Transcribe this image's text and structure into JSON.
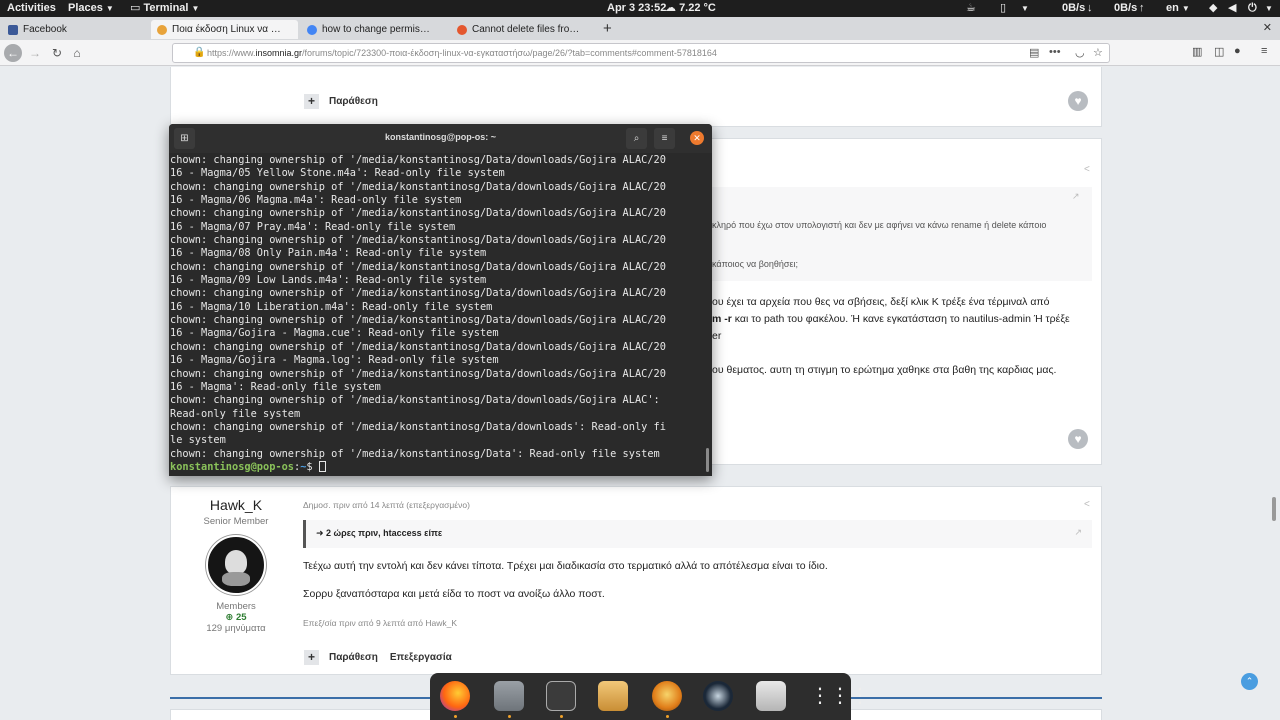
{
  "topbar": {
    "activities": "Activities",
    "places": "Places",
    "app_menu": "Terminal",
    "clock": "Apr 3  23:52",
    "weather": "7.22 °C",
    "net_down": "0B/s",
    "net_up": "0B/s",
    "keyboard": "en"
  },
  "browser": {
    "tabs": [
      {
        "label": "Facebook",
        "favicon_color": "#3b5998"
      },
      {
        "label": "Ποια έκδοση Linux να εγκαταστήσω",
        "favicon_color": "#e8a33a"
      },
      {
        "label": "how to change permissions",
        "favicon_color": "#4285f4"
      },
      {
        "label": "Cannot delete files from my",
        "favicon_color": "#e4572e"
      }
    ],
    "url_prefix": "https://www.",
    "url_host": "insomnia.gr",
    "url_path": "/forums/topic/723300-ποια-έκδοση-linux-να-εγκαταστήσω/page/26/?tab=comments#comment-57818164"
  },
  "page": {
    "post1_actions": {
      "quote_label": "Παράθεση"
    },
    "post2": {
      "quote_line1": "κληρό που έχω στον υπολογιστή και δεν με αφήνει να κάνω rename ή delete κάποιο",
      "quote_line2": "κάποιος να βοηθήσει;",
      "body_line1": "ου έχει τα αρχεία που θες να σβήσεις, δεξί κλικ Κ τρέξε ένα τέρμιναλ από",
      "body_line2_bold": "m -r",
      "body_line2_rest": " και το path του φακέλου. Ή κανε εγκατάσταση το nautilus-admin Ή τρέξε",
      "body_line3": "er",
      "body_line4": "ου θεματος. αυτη τη στιγμη το ερώτημα χαθηκε στα βαθη της καρδιας μας."
    },
    "post3": {
      "author": "Hawk_K",
      "rank": "Senior Member",
      "group": "Members",
      "reputation": "25",
      "post_count": "129 μηνύματα",
      "meta": "Δημοσ. πριν από 14 λεπτά (επεξεργασμένο)",
      "quote_header": "2 ώρες πριν, htaccess είπε",
      "body1": "Τεέχω αυτή την εντολή και δεν κάνει τίποτα. Τρέχει μαι διαδικασία στο τερματικό αλλά το απότέλεσμα είναι το ίδιο.",
      "body2": "Σορρυ ξαναπόσταρα και μετά είδα το ποστ να ανοίξω άλλο ποστ.",
      "edited": "Επεξ/σία πριν από 9 λεπτά από Hawk_K",
      "quote_label": "Παράθεση",
      "edit_label": "Επεξεργασία"
    }
  },
  "terminal": {
    "title": "konstantinosg@pop-os: ~",
    "lines": [
      "chown: changing ownership of '/media/konstantinosg/Data/downloads/Gojira ALAC/20",
      "16 - Magma/05 Yellow Stone.m4a': Read-only file system",
      "chown: changing ownership of '/media/konstantinosg/Data/downloads/Gojira ALAC/20",
      "16 - Magma/06 Magma.m4a': Read-only file system",
      "chown: changing ownership of '/media/konstantinosg/Data/downloads/Gojira ALAC/20",
      "16 - Magma/07 Pray.m4a': Read-only file system",
      "chown: changing ownership of '/media/konstantinosg/Data/downloads/Gojira ALAC/20",
      "16 - Magma/08 Only Pain.m4a': Read-only file system",
      "chown: changing ownership of '/media/konstantinosg/Data/downloads/Gojira ALAC/20",
      "16 - Magma/09 Low Lands.m4a': Read-only file system",
      "chown: changing ownership of '/media/konstantinosg/Data/downloads/Gojira ALAC/20",
      "16 - Magma/10 Liberation.m4a': Read-only file system",
      "chown: changing ownership of '/media/konstantinosg/Data/downloads/Gojira ALAC/20",
      "16 - Magma/Gojira - Magma.cue': Read-only file system",
      "chown: changing ownership of '/media/konstantinosg/Data/downloads/Gojira ALAC/20",
      "16 - Magma/Gojira - Magma.log': Read-only file system",
      "chown: changing ownership of '/media/konstantinosg/Data/downloads/Gojira ALAC/20",
      "16 - Magma': Read-only file system",
      "chown: changing ownership of '/media/konstantinosg/Data/downloads/Gojira ALAC':",
      "Read-only file system",
      "chown: changing ownership of '/media/konstantinosg/Data/downloads': Read-only fi",
      "le system",
      "chown: changing ownership of '/media/konstantinosg/Data': Read-only file system"
    ],
    "prompt_user": "konstantinosg@pop-os",
    "prompt_sep": ":",
    "prompt_dir": "~",
    "prompt_symbol": "$ "
  },
  "dock": {
    "apps": [
      "firefox-icon",
      "files-icon",
      "terminal-icon",
      "archive-manager-icon",
      "browser-icon",
      "steam-icon",
      "pop-shop-icon",
      "app-grid-icon"
    ]
  }
}
